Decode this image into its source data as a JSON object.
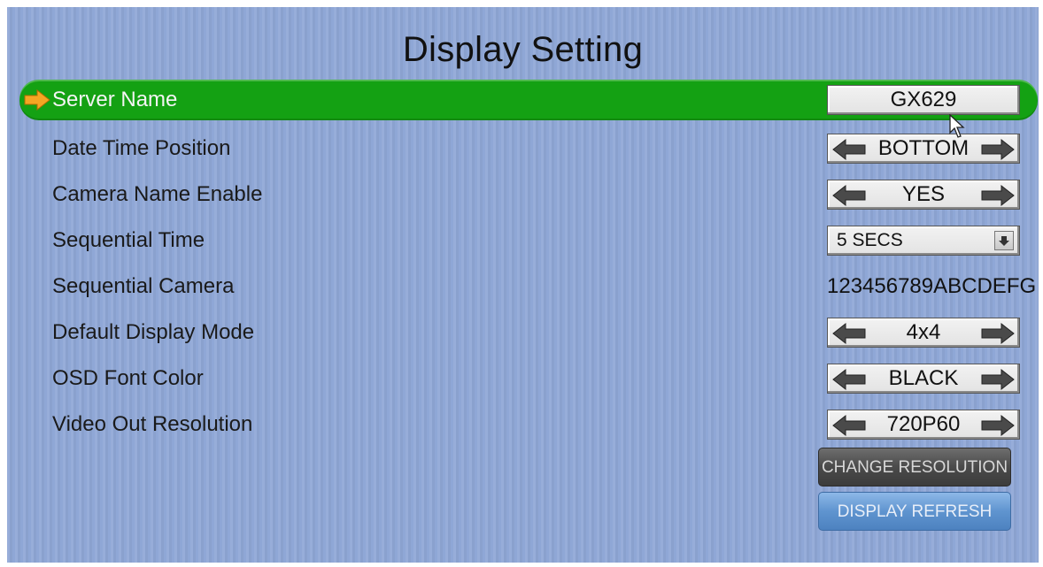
{
  "title": "Display Setting",
  "colors": {
    "background": "#8fa7d6",
    "selected_row": "#14a113",
    "arrow_marker": "#f5a623"
  },
  "rows": [
    {
      "label": "Server Name",
      "value": "GX629",
      "control": "text-field",
      "selected": true
    },
    {
      "label": "Date Time Position",
      "value": "BOTTOM",
      "control": "spinner"
    },
    {
      "label": "Camera Name Enable",
      "value": "YES",
      "control": "spinner"
    },
    {
      "label": "Sequential Time",
      "value": "5 SECS",
      "control": "dropdown"
    },
    {
      "label": "Sequential Camera",
      "value": "123456789ABCDEFG",
      "control": "static"
    },
    {
      "label": "Default Display Mode",
      "value": "4x4",
      "control": "spinner"
    },
    {
      "label": "OSD Font Color",
      "value": "BLACK",
      "control": "spinner"
    },
    {
      "label": "Video Out Resolution",
      "value": "720P60",
      "control": "spinner"
    }
  ],
  "buttons": {
    "change_resolution": "CHANGE RESOLUTION",
    "display_refresh": "DISPLAY REFRESH"
  },
  "icons": {
    "selection_marker": "arrow-right-icon",
    "spinner_left": "arrow-left-icon",
    "spinner_right": "arrow-right-icon",
    "dropdown": "chevron-down-icon",
    "pointer": "mouse-cursor-icon"
  }
}
